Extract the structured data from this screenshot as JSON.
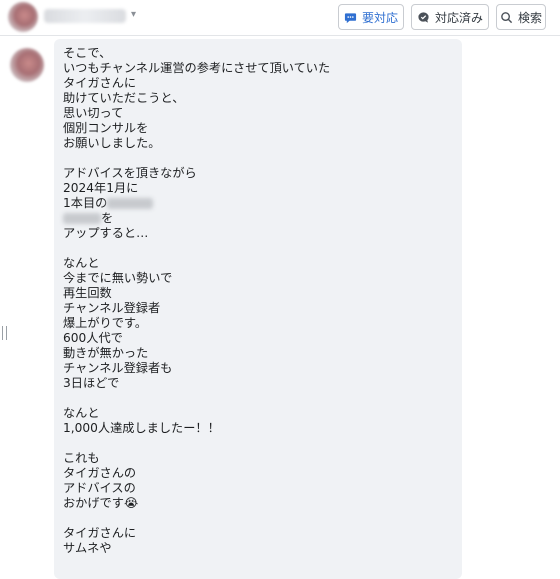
{
  "header": {
    "buttons": {
      "pending_label": "要対応",
      "done_label": "対応済み",
      "search_label": "検索"
    }
  },
  "message": {
    "lines": {
      "l01": "そこで、",
      "l02": "いつもチャンネル運営の参考にさせて頂いていた",
      "l03": "タイガさんに",
      "l04": "助けていただこうと、",
      "l05": "思い切って",
      "l06": "個別コンサルを",
      "l07": "お願いしました。",
      "l08": "アドバイスを頂きながら",
      "l09": "2024年1月に",
      "l10": "1本目の",
      "l11": "を",
      "l12": "アップすると…",
      "l13": "なんと",
      "l14": "今までに無い勢いで",
      "l15": "再生回数",
      "l16": "チャンネル登録者",
      "l17": "爆上がりです。",
      "l18": "600人代で",
      "l19": "動きが無かった",
      "l20": "チャンネル登録者も",
      "l21": "3日ほどで",
      "l22": "なんと",
      "l23": "1,000人達成しましたー！！",
      "l24": "これも",
      "l25": "タイガさんの",
      "l26": "アドバイスの",
      "l27": "おかげです",
      "l28": "タイガさんに",
      "l29": "サムネや"
    },
    "emoji": "😭"
  },
  "colors": {
    "accent": "#2f6fd1",
    "bubble": "#f0f2f5",
    "border": "#c9ccd1"
  },
  "icons": [
    "speech-bubble-icon",
    "chat-check-icon",
    "search-icon",
    "chevron-down-icon"
  ]
}
